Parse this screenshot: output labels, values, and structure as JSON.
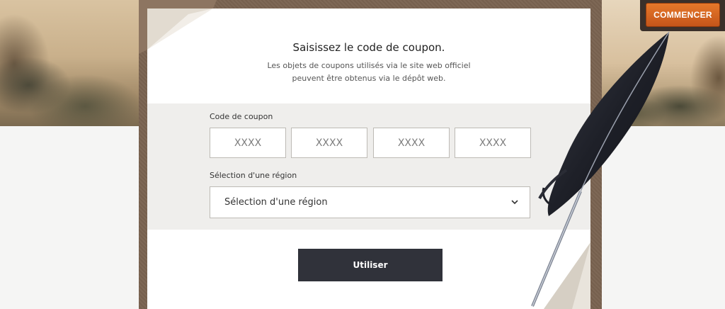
{
  "header": {
    "start_label": "COMMENCER"
  },
  "coupon": {
    "title": "Saisissez le code de coupon.",
    "subtitle": "Les objets de coupons utilisés via le site web officiel peuvent être obtenus via le dépôt web.",
    "code_label": "Code de coupon",
    "code_fields": [
      {
        "placeholder": "XXXX",
        "value": ""
      },
      {
        "placeholder": "XXXX",
        "value": ""
      },
      {
        "placeholder": "XXXX",
        "value": ""
      },
      {
        "placeholder": "XXXX",
        "value": ""
      }
    ],
    "region_label": "Sélection d'une région",
    "region_selected": "Sélection d'une région",
    "submit_label": "Utiliser"
  },
  "icons": {
    "chevron": "chevron-down-icon",
    "feather": "quill-feather-icon"
  },
  "colors": {
    "start_button": "#d9661f",
    "submit_button": "#30323a",
    "frame": "#7a6351",
    "form_band": "#efeeec"
  }
}
